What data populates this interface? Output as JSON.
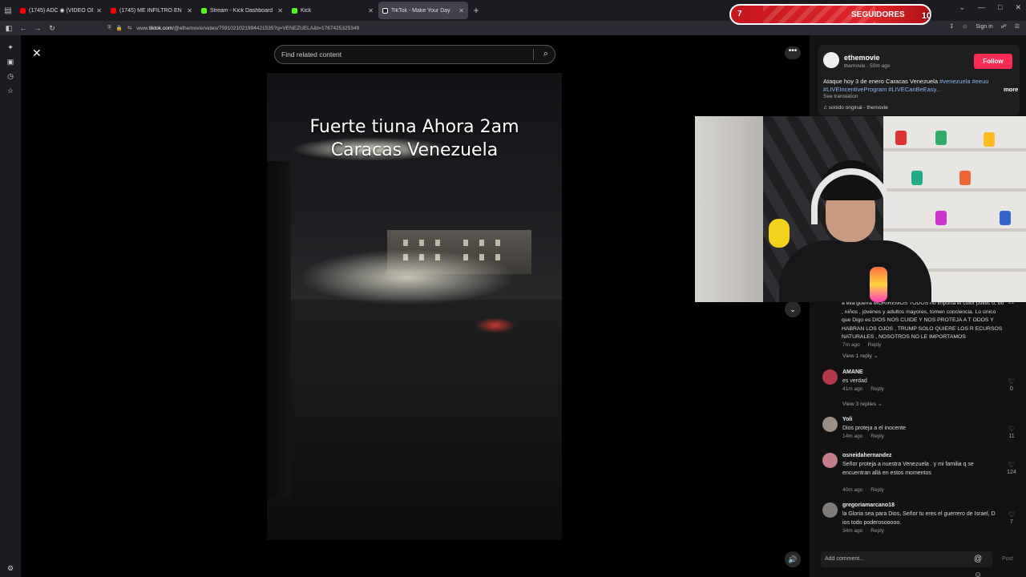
{
  "browser": {
    "tabs": [
      {
        "label": "(1745) ADC ◉ (VIDEO OFICIAL",
        "color": "#ff0000",
        "active": false
      },
      {
        "label": "(1745) ME INFILTRO EN LAS CA",
        "color": "#ff0000",
        "active": false
      },
      {
        "label": "Stream - Kick Dashboard",
        "color": "#53fc18",
        "active": false
      },
      {
        "label": "Kick",
        "color": "#53fc18",
        "active": false
      },
      {
        "label": "TikTok - Make Your Day",
        "color": "#ffffff",
        "active": true
      }
    ],
    "new_tab": "+",
    "url_prefix": "www.",
    "url_host": "tiktok.com",
    "url_path": "/@ethemovie/video/7591021021994421535?q=VENEZUELA&t=1767425325349",
    "sign_in": "Sign in"
  },
  "tiktok": {
    "search_placeholder": "Find related content",
    "video_caption_line1": "Fuerte tiuna Ahora 2am",
    "video_caption_line2": "Caracas Venezuela",
    "author_name": "ethemovie",
    "author_handle": "themovie",
    "author_time": "50m ago",
    "follow_label": "Follow",
    "desc_text": "Ataque hoy 3 de enero Caracas Venezuela ",
    "desc_tag1": "#venezuela",
    "desc_tag2": "#eeuu",
    "desc_tag3": "#LIVEIncentiveProgram",
    "desc_tag4": "#LIVECanBeEasy...",
    "more_label": "more",
    "see_translation": "See translation",
    "sound": "sonido original - themovie",
    "top_comment_text": "a ella guerra MORIREMOS TODOS no importa el color politic o, bb , niños , jóvenes y adultos mayores, tomen conciencia. Lo único que Digo es DIOS NOS CUIDE Y NOS PROTEJA A T ODOS Y HABRAN LOS OJOS , TRUMP SOLO QUIERE LOS R ECURSOS NATURALES , NOSOTROS NO LE IMPORTAMOS",
    "top_comment_likes": "22",
    "top_comment_time": "7m ago",
    "reply_label": "Reply",
    "view_1_reply": "View 1 reply",
    "comments": [
      {
        "user": "AMANE",
        "text": "es verdad",
        "time": "41m ago",
        "likes": "0",
        "avatar_color": "#b33a4a"
      },
      {
        "user": "Yoli",
        "text": "Dios proteja a el inocente",
        "time": "14m ago",
        "likes": "11",
        "avatar_color": "#9c8f86"
      },
      {
        "user": "osneidahernandez",
        "text": "Señor proteja a nuestra Venezuela . y mi familia q se encuentran allá en estos momentos",
        "time": "40m ago",
        "likes": "124",
        "avatar_color": "#c47d8a"
      },
      {
        "user": "gregoriamarcano18",
        "text": "la Gloria sea para Dios, Señor tu eres el guerrero de Israel, D ios todo poderosooooo.",
        "time": "34m ago",
        "likes": "7",
        "avatar_color": "#7e7b78"
      }
    ],
    "view_3_replies": "View 3 replies",
    "add_comment_placeholder": "Add comment...",
    "post_label": "Post"
  },
  "overlay": {
    "followers_left": "7",
    "followers_label": "SEGUIDORES",
    "followers_right": "10"
  },
  "icons": {
    "close": "✕",
    "search": "⌕",
    "more": "•••",
    "down": "⌄",
    "volume": "🔊",
    "heart": "♡",
    "at": "@",
    "emoji": "☺",
    "music": "♫"
  }
}
